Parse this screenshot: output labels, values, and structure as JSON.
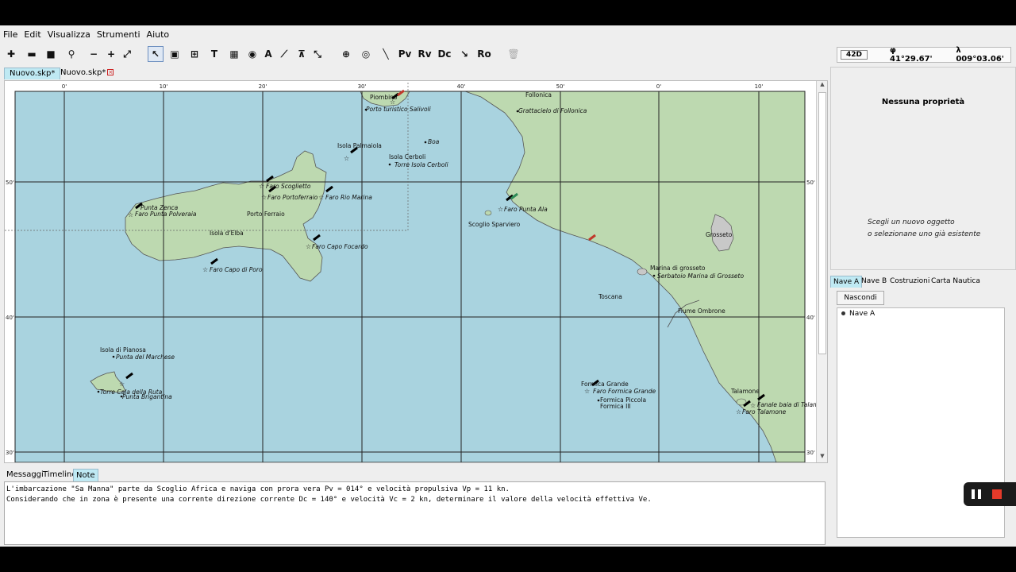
{
  "menu": [
    "File",
    "Edit",
    "Visualizza",
    "Strumenti",
    "Aiuto"
  ],
  "toolbar_icons": [
    {
      "name": "new-file-icon",
      "glyph": "✚"
    },
    {
      "name": "open-folder-icon",
      "glyph": "▬"
    },
    {
      "name": "save-icon",
      "glyph": "■"
    },
    {
      "name": "search-icon",
      "glyph": "⚲"
    },
    {
      "name": "zoom-out-icon",
      "glyph": "−"
    },
    {
      "name": "zoom-in-icon",
      "glyph": "+"
    },
    {
      "name": "fit-view-icon",
      "glyph": "⤢"
    },
    {
      "name": "select-tool-icon",
      "glyph": "↖"
    },
    {
      "name": "select-area-icon",
      "glyph": "▣"
    },
    {
      "name": "grid-icon",
      "glyph": "⊞"
    },
    {
      "name": "text-tool-icon",
      "glyph": "T"
    },
    {
      "name": "calculator-icon",
      "glyph": "▦"
    },
    {
      "name": "clock-tool-icon",
      "glyph": "◉"
    },
    {
      "name": "compass-icon",
      "glyph": "A"
    },
    {
      "name": "ruler-icon",
      "glyph": "⟋"
    },
    {
      "name": "triangle-icon",
      "glyph": "⊼"
    },
    {
      "name": "divider-icon",
      "glyph": "⤡"
    },
    {
      "name": "crosshair-icon",
      "glyph": "⊕"
    },
    {
      "name": "target-icon",
      "glyph": "◎"
    },
    {
      "name": "line-tool-icon",
      "glyph": "╲"
    },
    {
      "name": "pv-tool-icon",
      "glyph": "Pv"
    },
    {
      "name": "rv-tool-icon",
      "glyph": "Rv"
    },
    {
      "name": "dc-tool-icon",
      "glyph": "Dc"
    },
    {
      "name": "arrow-tool-icon",
      "glyph": "↘"
    },
    {
      "name": "ro-tool-icon",
      "glyph": "Ro"
    },
    {
      "name": "trash-icon",
      "glyph": "🗑"
    }
  ],
  "doc_tabs": [
    {
      "label": "Nuovo.skp*",
      "active": true
    },
    {
      "label": "Nuovo.skp*",
      "active": false
    }
  ],
  "map": {
    "top_ticks": [
      "0'",
      "10'",
      "20'",
      "30'",
      "40'",
      "50'",
      "0'",
      "10'"
    ],
    "side_ticks": [
      "50'",
      "40'",
      "30'"
    ],
    "labels": [
      {
        "text": "Piombino",
        "italic": false
      },
      {
        "text": "Porto turistico Salivoli",
        "italic": true
      },
      {
        "text": "Follonica",
        "italic": false
      },
      {
        "text": "Grattacielo di Follonica",
        "italic": true
      },
      {
        "text": "Boa",
        "italic": true
      },
      {
        "text": "Isola Palmaiola",
        "italic": false
      },
      {
        "text": "Isola Cerboli",
        "italic": false
      },
      {
        "text": "Torre Isola Cerboli",
        "italic": true
      },
      {
        "text": "Faro Scoglietto",
        "italic": true
      },
      {
        "text": "Faro Portoferraio",
        "italic": true
      },
      {
        "text": "Faro Rio Marina",
        "italic": true
      },
      {
        "text": "Punta Zenca",
        "italic": true
      },
      {
        "text": "Faro Punta Polveraia",
        "italic": true
      },
      {
        "text": "Porto Ferraio",
        "italic": false
      },
      {
        "text": "Isola d'Elba",
        "italic": false
      },
      {
        "text": "Faro Capo Focardo",
        "italic": true
      },
      {
        "text": "Faro Capo di Poro",
        "italic": true
      },
      {
        "text": "Faro Punta Ala",
        "italic": true
      },
      {
        "text": "Scoglio Sparviero",
        "italic": false
      },
      {
        "text": "Grosseto",
        "italic": false
      },
      {
        "text": "Marina di grosseto",
        "italic": false
      },
      {
        "text": "Serbatoio Marina di Grosseto",
        "italic": true
      },
      {
        "text": "Toscana",
        "italic": false
      },
      {
        "text": "Fiume Ombrone",
        "italic": false
      },
      {
        "text": "Isola di Pianosa",
        "italic": false
      },
      {
        "text": "Punta del Marchese",
        "italic": true
      },
      {
        "text": "Torre Cala della Ruta",
        "italic": true
      },
      {
        "text": "Punta Brigantina",
        "italic": true
      },
      {
        "text": "Formica Grande",
        "italic": false
      },
      {
        "text": "Faro Formica Grande",
        "italic": true
      },
      {
        "text": "Formica Piccola",
        "italic": false
      },
      {
        "text": "Formica III",
        "italic": false
      },
      {
        "text": "Talamone",
        "italic": false
      },
      {
        "text": "Fanale baia di Talamone",
        "italic": true
      },
      {
        "text": "Faro Talamone",
        "italic": true
      }
    ],
    "colors": {
      "sea": "#a9d3df",
      "land": "#bdd9b0",
      "coast": "#555555",
      "grid": "#222222"
    }
  },
  "bottom_tabs": [
    {
      "label": "Messaggi",
      "active": false
    },
    {
      "label": "Timeline",
      "active": false
    },
    {
      "label": "Note",
      "active": true
    }
  ],
  "notes": [
    "L'imbarcazione \"Sa Manna\" parte da Scoglio Africa e naviga con prora vera Pv = 014° e velocità propulsiva Vp = 11 kn.",
    "Considerando che in zona è presente una corrente direzione corrente Dc = 140° e velocità Vc = 2 kn, determinare il valore della velocità effettiva Ve."
  ],
  "coords": {
    "zoom": "42D",
    "lat": "φ 41°29.67'",
    "lon": "λ 009°03.06'"
  },
  "properties": {
    "title": "Nessuna proprietà",
    "hint1": "Scegli un nuovo oggetto",
    "hint2": "o selezionane uno già esistente"
  },
  "right_tabs": [
    {
      "label": "Nave A",
      "active": true
    },
    {
      "label": "Nave B",
      "active": false
    },
    {
      "label": "Costruzioni",
      "active": false
    },
    {
      "label": "Carta Nautica",
      "active": false
    }
  ],
  "hide_button": "Nascondi",
  "ship_list": [
    "Nave A"
  ]
}
